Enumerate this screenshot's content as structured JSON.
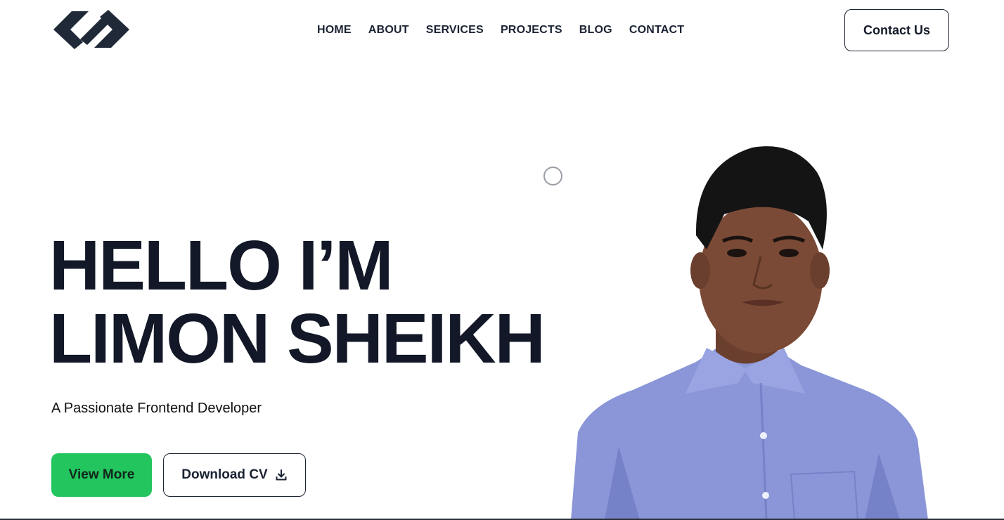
{
  "brand": {
    "logo_icon": "chain-link-logo-icon",
    "color": "#1f2937"
  },
  "nav": {
    "items": [
      {
        "label": "HOME"
      },
      {
        "label": "ABOUT"
      },
      {
        "label": "SERVICES"
      },
      {
        "label": "PROJECTS"
      },
      {
        "label": "BLOG"
      },
      {
        "label": "CONTACT"
      }
    ]
  },
  "header": {
    "contact_label": "Contact Us"
  },
  "hero": {
    "title_line1": "HELLO I’M",
    "title_line2": "LIMON SHEIKH",
    "subtitle": "A Passionate Frontend Developer",
    "primary_label": "View More",
    "secondary_label": "Download CV",
    "secondary_icon": "download-icon"
  },
  "colors": {
    "accent": "#22c55e",
    "text": "#121827",
    "shirt": "#8a96d8"
  }
}
